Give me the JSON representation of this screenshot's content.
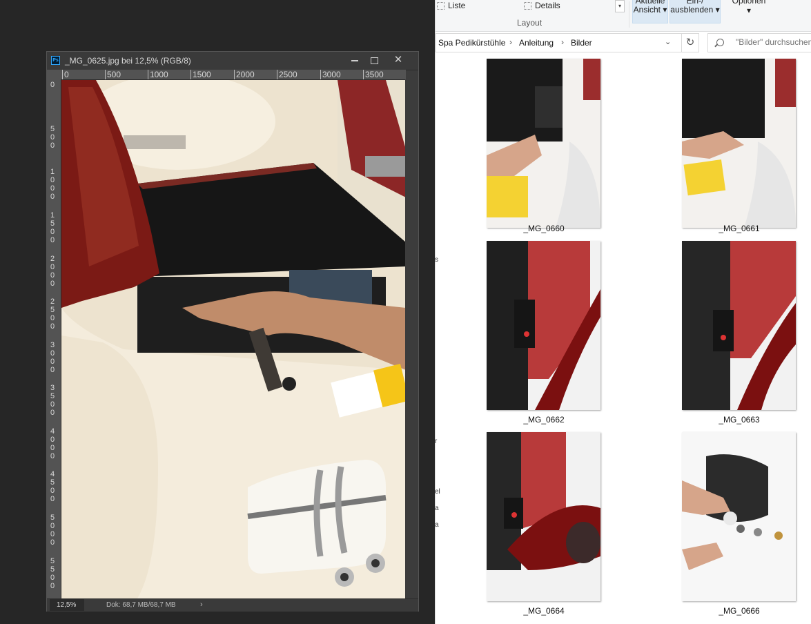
{
  "photoshop": {
    "app_icon": "Ps",
    "title": "_MG_0625.jpg bei 12,5% (RGB/8)",
    "ruler_h": [
      "0",
      "500",
      "1000",
      "1500",
      "2000",
      "2500",
      "3000",
      "3500"
    ],
    "ruler_v": [
      "0",
      "500",
      "1000",
      "1500",
      "2000",
      "2500",
      "3000",
      "3500",
      "4000",
      "4500",
      "5000",
      "5500"
    ],
    "zoom": "12,5%",
    "doc_info": "Dok: 68,7 MB/68,7 MB",
    "arrow": "›"
  },
  "explorer": {
    "ribbon": {
      "list_label": "Liste",
      "details_label": "Details",
      "current_view": "Aktuelle Ansicht",
      "show_hide": "Ein-/ ausblenden",
      "options": "Optionen",
      "layout_group": "Layout"
    },
    "breadcrumb": [
      "Spa Pedikürstühle",
      "Anleitung",
      "Bilder"
    ],
    "search_placeholder": "\"Bilder\" durchsuchen",
    "thumbnails": [
      {
        "name": "_MG_0660"
      },
      {
        "name": "_MG_0661"
      },
      {
        "name": "_MG_0662"
      },
      {
        "name": "_MG_0663"
      },
      {
        "name": "_MG_0664"
      },
      {
        "name": "_MG_0666"
      }
    ],
    "nav_fragments": [
      "s",
      "r",
      "el",
      "a",
      "a"
    ]
  },
  "colors": {
    "ps_bg": "#262626",
    "ps_panel": "#3c3c3c",
    "explorer_bg": "#ffffff",
    "ribbon_selected": "#dbe8f4"
  }
}
